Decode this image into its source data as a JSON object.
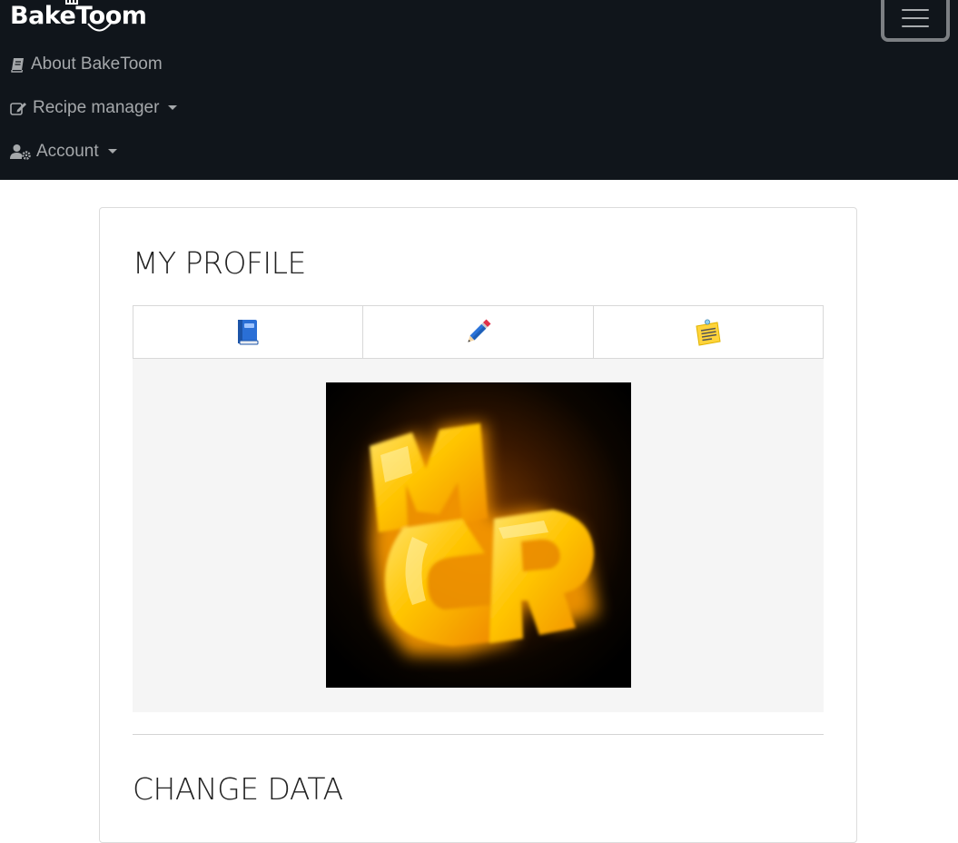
{
  "brand": {
    "name": "BakeToom"
  },
  "navbar": {
    "toggler_icon": "hamburger-icon",
    "links": [
      {
        "label": "About BakeToom",
        "icon": "book-icon"
      },
      {
        "label": "Recipe manager",
        "icon": "edit-icon",
        "dropdown": true
      },
      {
        "label": "Account",
        "icon": "user-gear-icon",
        "dropdown": true
      }
    ]
  },
  "profile": {
    "title": "MY PROFILE",
    "tabs": [
      {
        "icon": "blue-book-icon"
      },
      {
        "icon": "pencil-icon"
      },
      {
        "icon": "memo-icon"
      }
    ],
    "avatar": {
      "glyphs": "MCR"
    }
  },
  "change_data": {
    "title": "CHANGE DATA"
  },
  "colors": {
    "navbar_bg": "#10151b",
    "nav_text": "#a5a8ab",
    "panel_bg": "#f5f5f5",
    "avatar_glow": "#ffc400"
  }
}
